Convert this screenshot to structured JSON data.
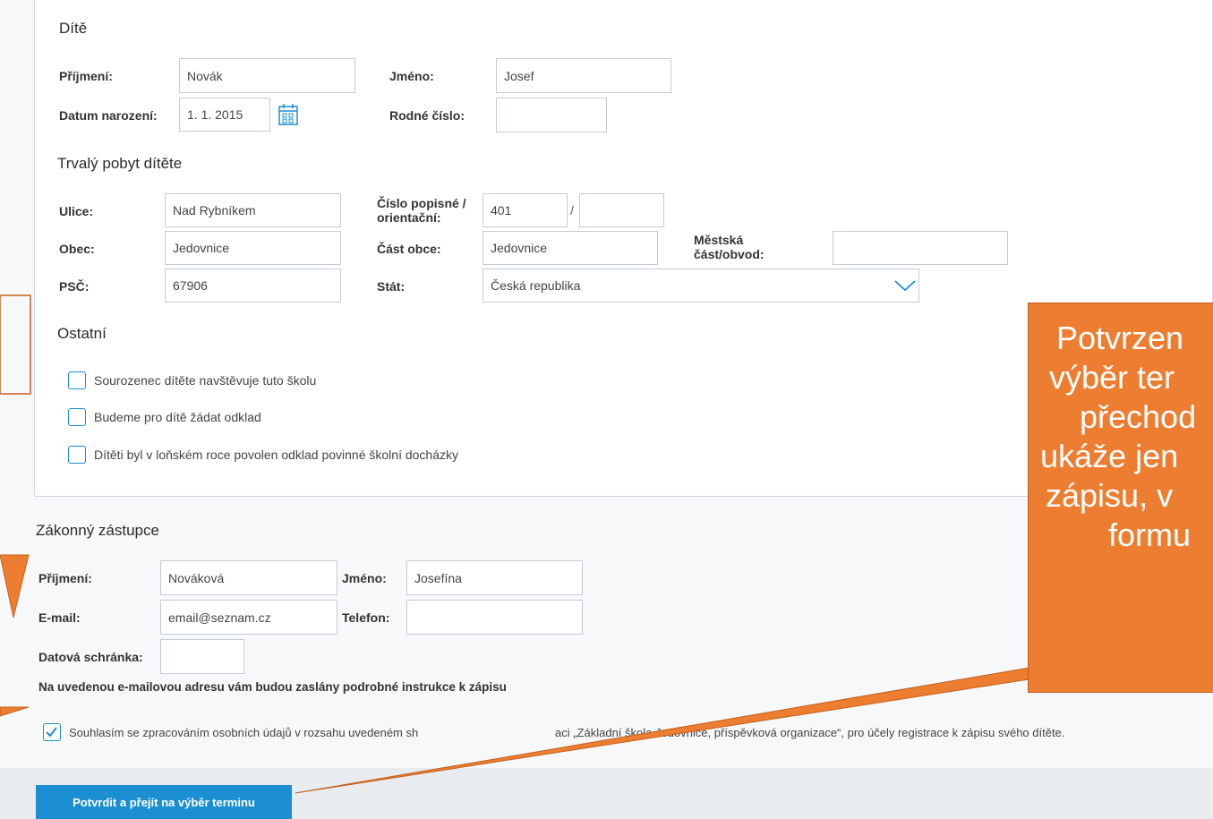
{
  "child": {
    "title": "Dítě",
    "surname_label": "Příjmení:",
    "surname_value": "Novák",
    "firstname_label": "Jméno:",
    "firstname_value": "Josef",
    "dob_label": "Datum narození:",
    "dob_value": "1. 1. 2015",
    "birth_number_label": "Rodné číslo:",
    "birth_number_value": ""
  },
  "residence": {
    "title": "Trvalý pobyt dítěte",
    "street_label": "Ulice:",
    "street_value": "Nad Rybníkem",
    "number_label_1": "Číslo popisné /",
    "number_label_2": "orientační:",
    "number_value": "401",
    "number_separator": "/",
    "orient_value": "",
    "town_label": "Obec:",
    "town_value": "Jedovnice",
    "town_part_label": "Část obce:",
    "town_part_value": "Jedovnice",
    "district_label_1": "Městská",
    "district_label_2": "část/obvod:",
    "district_value": "",
    "zip_label": "PSČ:",
    "zip_value": "67906",
    "country_label": "Stát:",
    "country_value": "Česká republika"
  },
  "other": {
    "title": "Ostatní",
    "options": [
      "Sourozenec dítěte navštěvuje tuto školu",
      "Budeme pro dítě žádat odklad",
      "Dítěti byl v loňském roce povolen odklad povinné školní docházky"
    ]
  },
  "guardian": {
    "title": "Zákonný zástupce",
    "surname_label": "Příjmení:",
    "surname_value": "Nováková",
    "firstname_label": "Jméno:",
    "firstname_value": "Josefína",
    "email_label": "E-mail:",
    "email_value": "email@seznam.cz",
    "phone_label": "Telefon:",
    "phone_value": "",
    "databox_label": "Datová schránka:",
    "databox_value": "",
    "note": "Na uvedenou e-mailovou adresu vám budou zaslány podrobné instrukce k zápisu"
  },
  "consent": {
    "text_left": "Souhlasím se zpracováním osobních údajů v rozsahu uvedeném sh",
    "text_right": "aci „Základní škola Jedovnice, příspěvková organizace“, pro účely registrace k zápisu svého dítěte.",
    "checked": true
  },
  "submit_label": "Potvrdit a přejít na výběr terminu",
  "callout": {
    "lines": [
      "Potvrzen",
      "výběr ter",
      "přechod",
      "ukáže jen",
      "zápisu, v",
      "formu"
    ]
  },
  "colors": {
    "accent": "#1b8fd1",
    "callout": "#ed7d31"
  }
}
